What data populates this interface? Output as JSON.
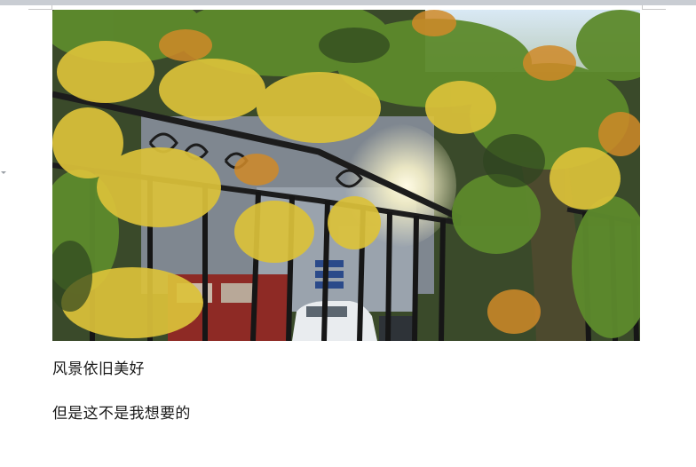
{
  "document": {
    "paragraphs": [
      "风景依旧美好",
      "但是这不是我想要的"
    ]
  },
  "image": {
    "description_icon": "photo-autumn-vines-fence",
    "signs": [
      "",
      "",
      ""
    ]
  },
  "colors": {
    "page": "#ffffff",
    "text": "#1a1a1a",
    "leaf_yellow": "#e2c23a",
    "leaf_green": "#6f9a32",
    "fence": "#1c1c1c"
  }
}
